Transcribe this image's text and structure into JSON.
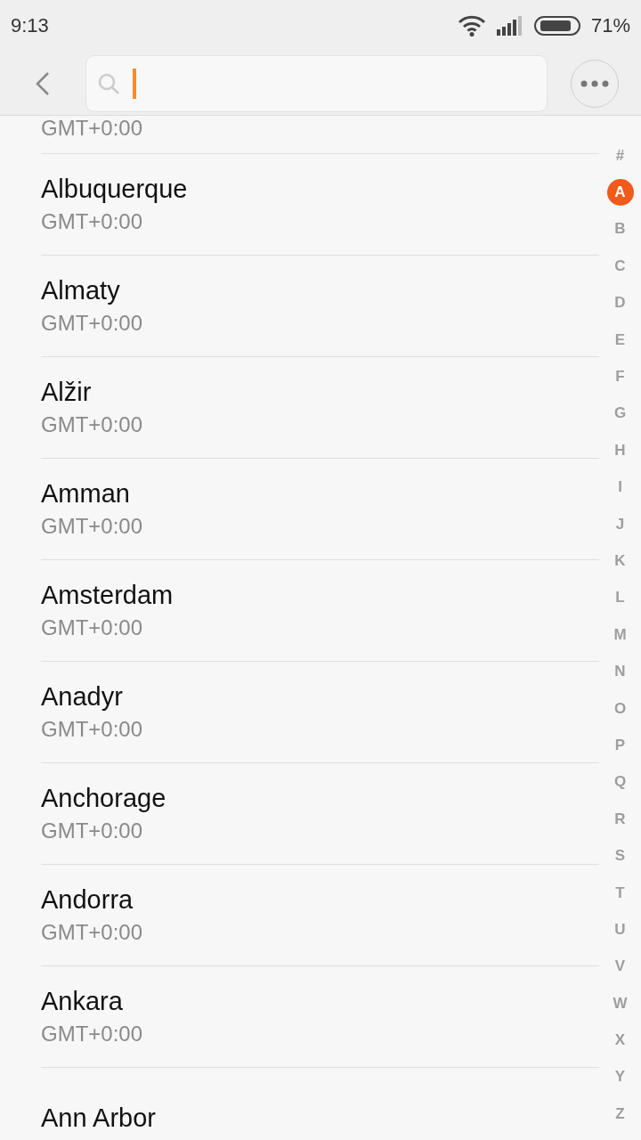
{
  "status_bar": {
    "time": "9:13",
    "battery": "71%"
  },
  "cities": [
    {
      "subtitle": "GMT+0:00",
      "partial": true
    },
    {
      "name": "Albuquerque",
      "subtitle": "GMT+0:00"
    },
    {
      "name": "Almaty",
      "subtitle": "GMT+0:00"
    },
    {
      "name": "Alžir",
      "subtitle": "GMT+0:00"
    },
    {
      "name": "Amman",
      "subtitle": "GMT+0:00"
    },
    {
      "name": "Amsterdam",
      "subtitle": "GMT+0:00"
    },
    {
      "name": "Anadyr",
      "subtitle": "GMT+0:00"
    },
    {
      "name": "Anchorage",
      "subtitle": "GMT+0:00"
    },
    {
      "name": "Andorra",
      "subtitle": "GMT+0:00"
    },
    {
      "name": "Ankara",
      "subtitle": "GMT+0:00"
    },
    {
      "name": "Ann Arbor"
    }
  ],
  "index": [
    {
      "label": "#",
      "selected": false
    },
    {
      "label": "A",
      "selected": true
    },
    {
      "label": "B",
      "selected": false
    },
    {
      "label": "C",
      "selected": false
    },
    {
      "label": "D",
      "selected": false
    },
    {
      "label": "E",
      "selected": false
    },
    {
      "label": "F",
      "selected": false
    },
    {
      "label": "G",
      "selected": false
    },
    {
      "label": "H",
      "selected": false
    },
    {
      "label": "I",
      "selected": false
    },
    {
      "label": "J",
      "selected": false
    },
    {
      "label": "K",
      "selected": false
    },
    {
      "label": "L",
      "selected": false
    },
    {
      "label": "M",
      "selected": false
    },
    {
      "label": "N",
      "selected": false
    },
    {
      "label": "O",
      "selected": false
    },
    {
      "label": "P",
      "selected": false
    },
    {
      "label": "Q",
      "selected": false
    },
    {
      "label": "R",
      "selected": false
    },
    {
      "label": "S",
      "selected": false
    },
    {
      "label": "T",
      "selected": false
    },
    {
      "label": "U",
      "selected": false
    },
    {
      "label": "V",
      "selected": false
    },
    {
      "label": "W",
      "selected": false
    },
    {
      "label": "X",
      "selected": false
    },
    {
      "label": "Y",
      "selected": false
    },
    {
      "label": "Z",
      "selected": false
    }
  ]
}
